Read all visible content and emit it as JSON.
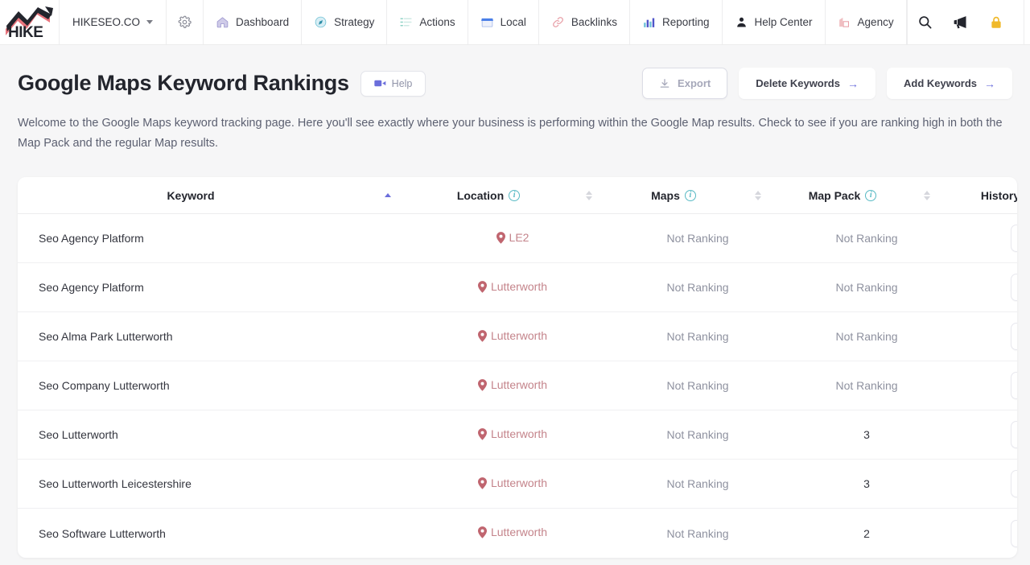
{
  "navbar": {
    "logo_alt": "HIKE",
    "brand": {
      "label": "HIKESEO.CO",
      "icon": "chevron-down-icon"
    },
    "settings_icon": "gear-icon",
    "items": [
      {
        "label": "Dashboard",
        "icon": "home-icon"
      },
      {
        "label": "Strategy",
        "icon": "compass-icon"
      },
      {
        "label": "Actions",
        "icon": "checklist-icon"
      },
      {
        "label": "Local",
        "icon": "storefront-icon"
      },
      {
        "label": "Backlinks",
        "icon": "link-icon"
      },
      {
        "label": "Reporting",
        "icon": "bar-chart-icon"
      },
      {
        "label": "Help Center",
        "icon": "user-support-icon"
      },
      {
        "label": "Agency",
        "icon": "buildings-icon"
      }
    ],
    "right_icons": [
      {
        "name": "search-icon"
      },
      {
        "name": "megaphone-icon"
      },
      {
        "name": "lock-icon"
      },
      {
        "name": "avatar-icon"
      }
    ]
  },
  "header": {
    "title": "Google Maps Keyword Rankings",
    "help_label": "Help",
    "help_icon": "video-camera-icon",
    "buttons": [
      {
        "label": "Export",
        "icon": "download-icon",
        "style": "outline"
      },
      {
        "label": "Delete Keywords",
        "arrow": "→",
        "style": "solid"
      },
      {
        "label": "Add Keywords",
        "arrow": "→",
        "style": "solid"
      }
    ]
  },
  "description": "Welcome to the Google Maps keyword tracking page. Here you'll see exactly where your business is performing within the Google Map results. Check to see if you are ranking high in both the Map Pack and the regular Map results.",
  "table": {
    "columns": [
      {
        "key": "keyword",
        "label": "Keyword",
        "info": false,
        "sort": "asc"
      },
      {
        "key": "location",
        "label": "Location",
        "info": true,
        "sort": "none"
      },
      {
        "key": "maps",
        "label": "Maps",
        "info": true,
        "sort": "none"
      },
      {
        "key": "map_pack",
        "label": "Map Pack",
        "info": true,
        "sort": "none"
      },
      {
        "key": "history",
        "label": "History",
        "info": false,
        "sort": "none"
      }
    ],
    "history_icon": "chart-icon",
    "location_icon": "map-pin-icon",
    "rows": [
      {
        "keyword": "Seo Agency Platform",
        "location": "LE2",
        "maps": "Not Ranking",
        "map_pack": "Not Ranking"
      },
      {
        "keyword": "Seo Agency Platform",
        "location": "Lutterworth",
        "maps": "Not Ranking",
        "map_pack": "Not Ranking"
      },
      {
        "keyword": "Seo Alma Park Lutterworth",
        "location": "Lutterworth",
        "maps": "Not Ranking",
        "map_pack": "Not Ranking"
      },
      {
        "keyword": "Seo Company Lutterworth",
        "location": "Lutterworth",
        "maps": "Not Ranking",
        "map_pack": "Not Ranking"
      },
      {
        "keyword": "Seo Lutterworth",
        "location": "Lutterworth",
        "maps": "Not Ranking",
        "map_pack": "3"
      },
      {
        "keyword": "Seo Lutterworth Leicestershire",
        "location": "Lutterworth",
        "maps": "Not Ranking",
        "map_pack": "3"
      },
      {
        "keyword": "Seo Software Lutterworth",
        "location": "Lutterworth",
        "maps": "Not Ranking",
        "map_pack": "2"
      }
    ]
  },
  "colors": {
    "accent_purple": "#6b6edb",
    "info_teal": "#57b9c4",
    "location_red": "#c4848b",
    "page_bg": "#f6f6f7",
    "lock_yellow": "#f0b92a"
  }
}
